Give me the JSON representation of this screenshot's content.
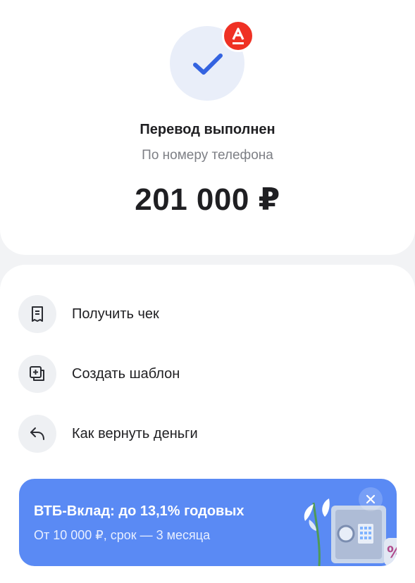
{
  "header": {
    "status_icon": "checkmark-icon",
    "bank_badge_icon": "alfa-bank-logo",
    "title": "Перевод выполнен",
    "subtitle": "По номеру телефона",
    "amount": "201 000 ₽"
  },
  "actions": [
    {
      "label": "Получить чек",
      "icon": "receipt-icon"
    },
    {
      "label": "Создать шаблон",
      "icon": "template-add-icon"
    },
    {
      "label": "Как вернуть деньги",
      "icon": "return-arrow-icon"
    }
  ],
  "promo": {
    "title": "ВТБ-Вклад: до 13,1% годовых",
    "subtitle": "От 10 000 ₽, срок — 3 месяца",
    "close_icon": "close-icon",
    "background": "#5a8af4"
  },
  "colors": {
    "accent_blue": "#3463e0",
    "bank_red": "#ef3124",
    "text_primary": "#1f1f22",
    "text_secondary": "#7d7f85"
  }
}
